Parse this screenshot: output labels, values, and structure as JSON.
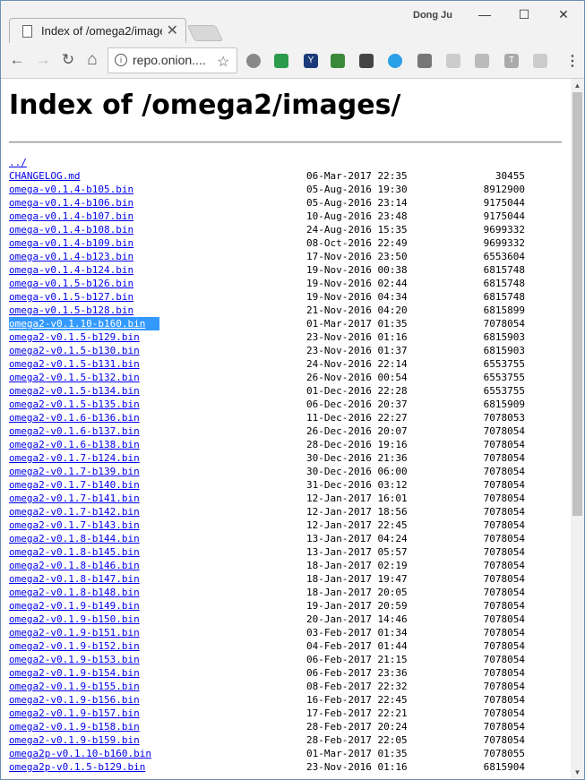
{
  "browser": {
    "tab_title": "Index of /omega2/images/",
    "tab_close": "✕",
    "profile_name": "Dong Ju",
    "url": "repo.onion....",
    "nav": {
      "back": "←",
      "forward": "→",
      "reload": "↻",
      "home": "⌂"
    },
    "window_buttons": {
      "minimize": "—",
      "maximize": "☐",
      "close": "✕"
    },
    "extensions": [
      "opera-icon",
      "drive-icon",
      "y-icon",
      "evernote-green-icon",
      "evernote-icon",
      "cloud-icon",
      "notes-icon",
      "shield-icon",
      "rss-icon",
      "t-icon",
      "translate-icon"
    ]
  },
  "page": {
    "heading": "Index of /omega2/images/",
    "parent_link": "../",
    "files": [
      {
        "name": "CHANGELOG.md",
        "date": "06-Mar-2017 22:35",
        "size": "30455"
      },
      {
        "name": "omega-v0.1.4-b105.bin",
        "date": "05-Aug-2016 19:30",
        "size": "8912900"
      },
      {
        "name": "omega-v0.1.4-b106.bin",
        "date": "05-Aug-2016 23:14",
        "size": "9175044"
      },
      {
        "name": "omega-v0.1.4-b107.bin",
        "date": "10-Aug-2016 23:48",
        "size": "9175044"
      },
      {
        "name": "omega-v0.1.4-b108.bin",
        "date": "24-Aug-2016 15:35",
        "size": "9699332"
      },
      {
        "name": "omega-v0.1.4-b109.bin",
        "date": "08-Oct-2016 22:49",
        "size": "9699332"
      },
      {
        "name": "omega-v0.1.4-b123.bin",
        "date": "17-Nov-2016 23:50",
        "size": "6553604"
      },
      {
        "name": "omega-v0.1.4-b124.bin",
        "date": "19-Nov-2016 00:38",
        "size": "6815748"
      },
      {
        "name": "omega-v0.1.5-b126.bin",
        "date": "19-Nov-2016 02:44",
        "size": "6815748"
      },
      {
        "name": "omega-v0.1.5-b127.bin",
        "date": "19-Nov-2016 04:34",
        "size": "6815748"
      },
      {
        "name": "omega-v0.1.5-b128.bin",
        "date": "21-Nov-2016 04:20",
        "size": "6815899"
      },
      {
        "name": "omega2-v0.1.10-b160.bin",
        "date": "01-Mar-2017 01:35",
        "size": "7078054",
        "selected": true
      },
      {
        "name": "omega2-v0.1.5-b129.bin",
        "date": "23-Nov-2016 01:16",
        "size": "6815903"
      },
      {
        "name": "omega2-v0.1.5-b130.bin",
        "date": "23-Nov-2016 01:37",
        "size": "6815903"
      },
      {
        "name": "omega2-v0.1.5-b131.bin",
        "date": "24-Nov-2016 22:14",
        "size": "6553755"
      },
      {
        "name": "omega2-v0.1.5-b132.bin",
        "date": "26-Nov-2016 00:54",
        "size": "6553755"
      },
      {
        "name": "omega2-v0.1.5-b134.bin",
        "date": "01-Dec-2016 22:28",
        "size": "6553755"
      },
      {
        "name": "omega2-v0.1.5-b135.bin",
        "date": "06-Dec-2016 20:37",
        "size": "6815909"
      },
      {
        "name": "omega2-v0.1.6-b136.bin",
        "date": "11-Dec-2016 22:27",
        "size": "7078053"
      },
      {
        "name": "omega2-v0.1.6-b137.bin",
        "date": "26-Dec-2016 20:07",
        "size": "7078054"
      },
      {
        "name": "omega2-v0.1.6-b138.bin",
        "date": "28-Dec-2016 19:16",
        "size": "7078054"
      },
      {
        "name": "omega2-v0.1.7-b124.bin",
        "date": "30-Dec-2016 21:36",
        "size": "7078054"
      },
      {
        "name": "omega2-v0.1.7-b139.bin",
        "date": "30-Dec-2016 06:00",
        "size": "7078054"
      },
      {
        "name": "omega2-v0.1.7-b140.bin",
        "date": "31-Dec-2016 03:12",
        "size": "7078054"
      },
      {
        "name": "omega2-v0.1.7-b141.bin",
        "date": "12-Jan-2017 16:01",
        "size": "7078054"
      },
      {
        "name": "omega2-v0.1.7-b142.bin",
        "date": "12-Jan-2017 18:56",
        "size": "7078054"
      },
      {
        "name": "omega2-v0.1.7-b143.bin",
        "date": "12-Jan-2017 22:45",
        "size": "7078054"
      },
      {
        "name": "omega2-v0.1.8-b144.bin",
        "date": "13-Jan-2017 04:24",
        "size": "7078054"
      },
      {
        "name": "omega2-v0.1.8-b145.bin",
        "date": "13-Jan-2017 05:57",
        "size": "7078054"
      },
      {
        "name": "omega2-v0.1.8-b146.bin",
        "date": "18-Jan-2017 02:19",
        "size": "7078054"
      },
      {
        "name": "omega2-v0.1.8-b147.bin",
        "date": "18-Jan-2017 19:47",
        "size": "7078054"
      },
      {
        "name": "omega2-v0.1.8-b148.bin",
        "date": "18-Jan-2017 20:05",
        "size": "7078054"
      },
      {
        "name": "omega2-v0.1.9-b149.bin",
        "date": "19-Jan-2017 20:59",
        "size": "7078054"
      },
      {
        "name": "omega2-v0.1.9-b150.bin",
        "date": "20-Jan-2017 14:46",
        "size": "7078054"
      },
      {
        "name": "omega2-v0.1.9-b151.bin",
        "date": "03-Feb-2017 01:34",
        "size": "7078054"
      },
      {
        "name": "omega2-v0.1.9-b152.bin",
        "date": "04-Feb-2017 01:44",
        "size": "7078054"
      },
      {
        "name": "omega2-v0.1.9-b153.bin",
        "date": "06-Feb-2017 21:15",
        "size": "7078054"
      },
      {
        "name": "omega2-v0.1.9-b154.bin",
        "date": "06-Feb-2017 23:36",
        "size": "7078054"
      },
      {
        "name": "omega2-v0.1.9-b155.bin",
        "date": "08-Feb-2017 22:32",
        "size": "7078054"
      },
      {
        "name": "omega2-v0.1.9-b156.bin",
        "date": "16-Feb-2017 22:45",
        "size": "7078054"
      },
      {
        "name": "omega2-v0.1.9-b157.bin",
        "date": "17-Feb-2017 22:21",
        "size": "7078054"
      },
      {
        "name": "omega2-v0.1.9-b158.bin",
        "date": "28-Feb-2017 20:24",
        "size": "7078054"
      },
      {
        "name": "omega2-v0.1.9-b159.bin",
        "date": "28-Feb-2017 22:05",
        "size": "7078054"
      },
      {
        "name": "omega2p-v0.1.10-b160.bin",
        "date": "01-Mar-2017 01:35",
        "size": "7078055"
      },
      {
        "name": "omega2p-v0.1.5-b129.bin",
        "date": "23-Nov-2016 01:16",
        "size": "6815904"
      }
    ]
  },
  "colors": {
    "link": "#0000ee",
    "selection": "#3399ff"
  }
}
